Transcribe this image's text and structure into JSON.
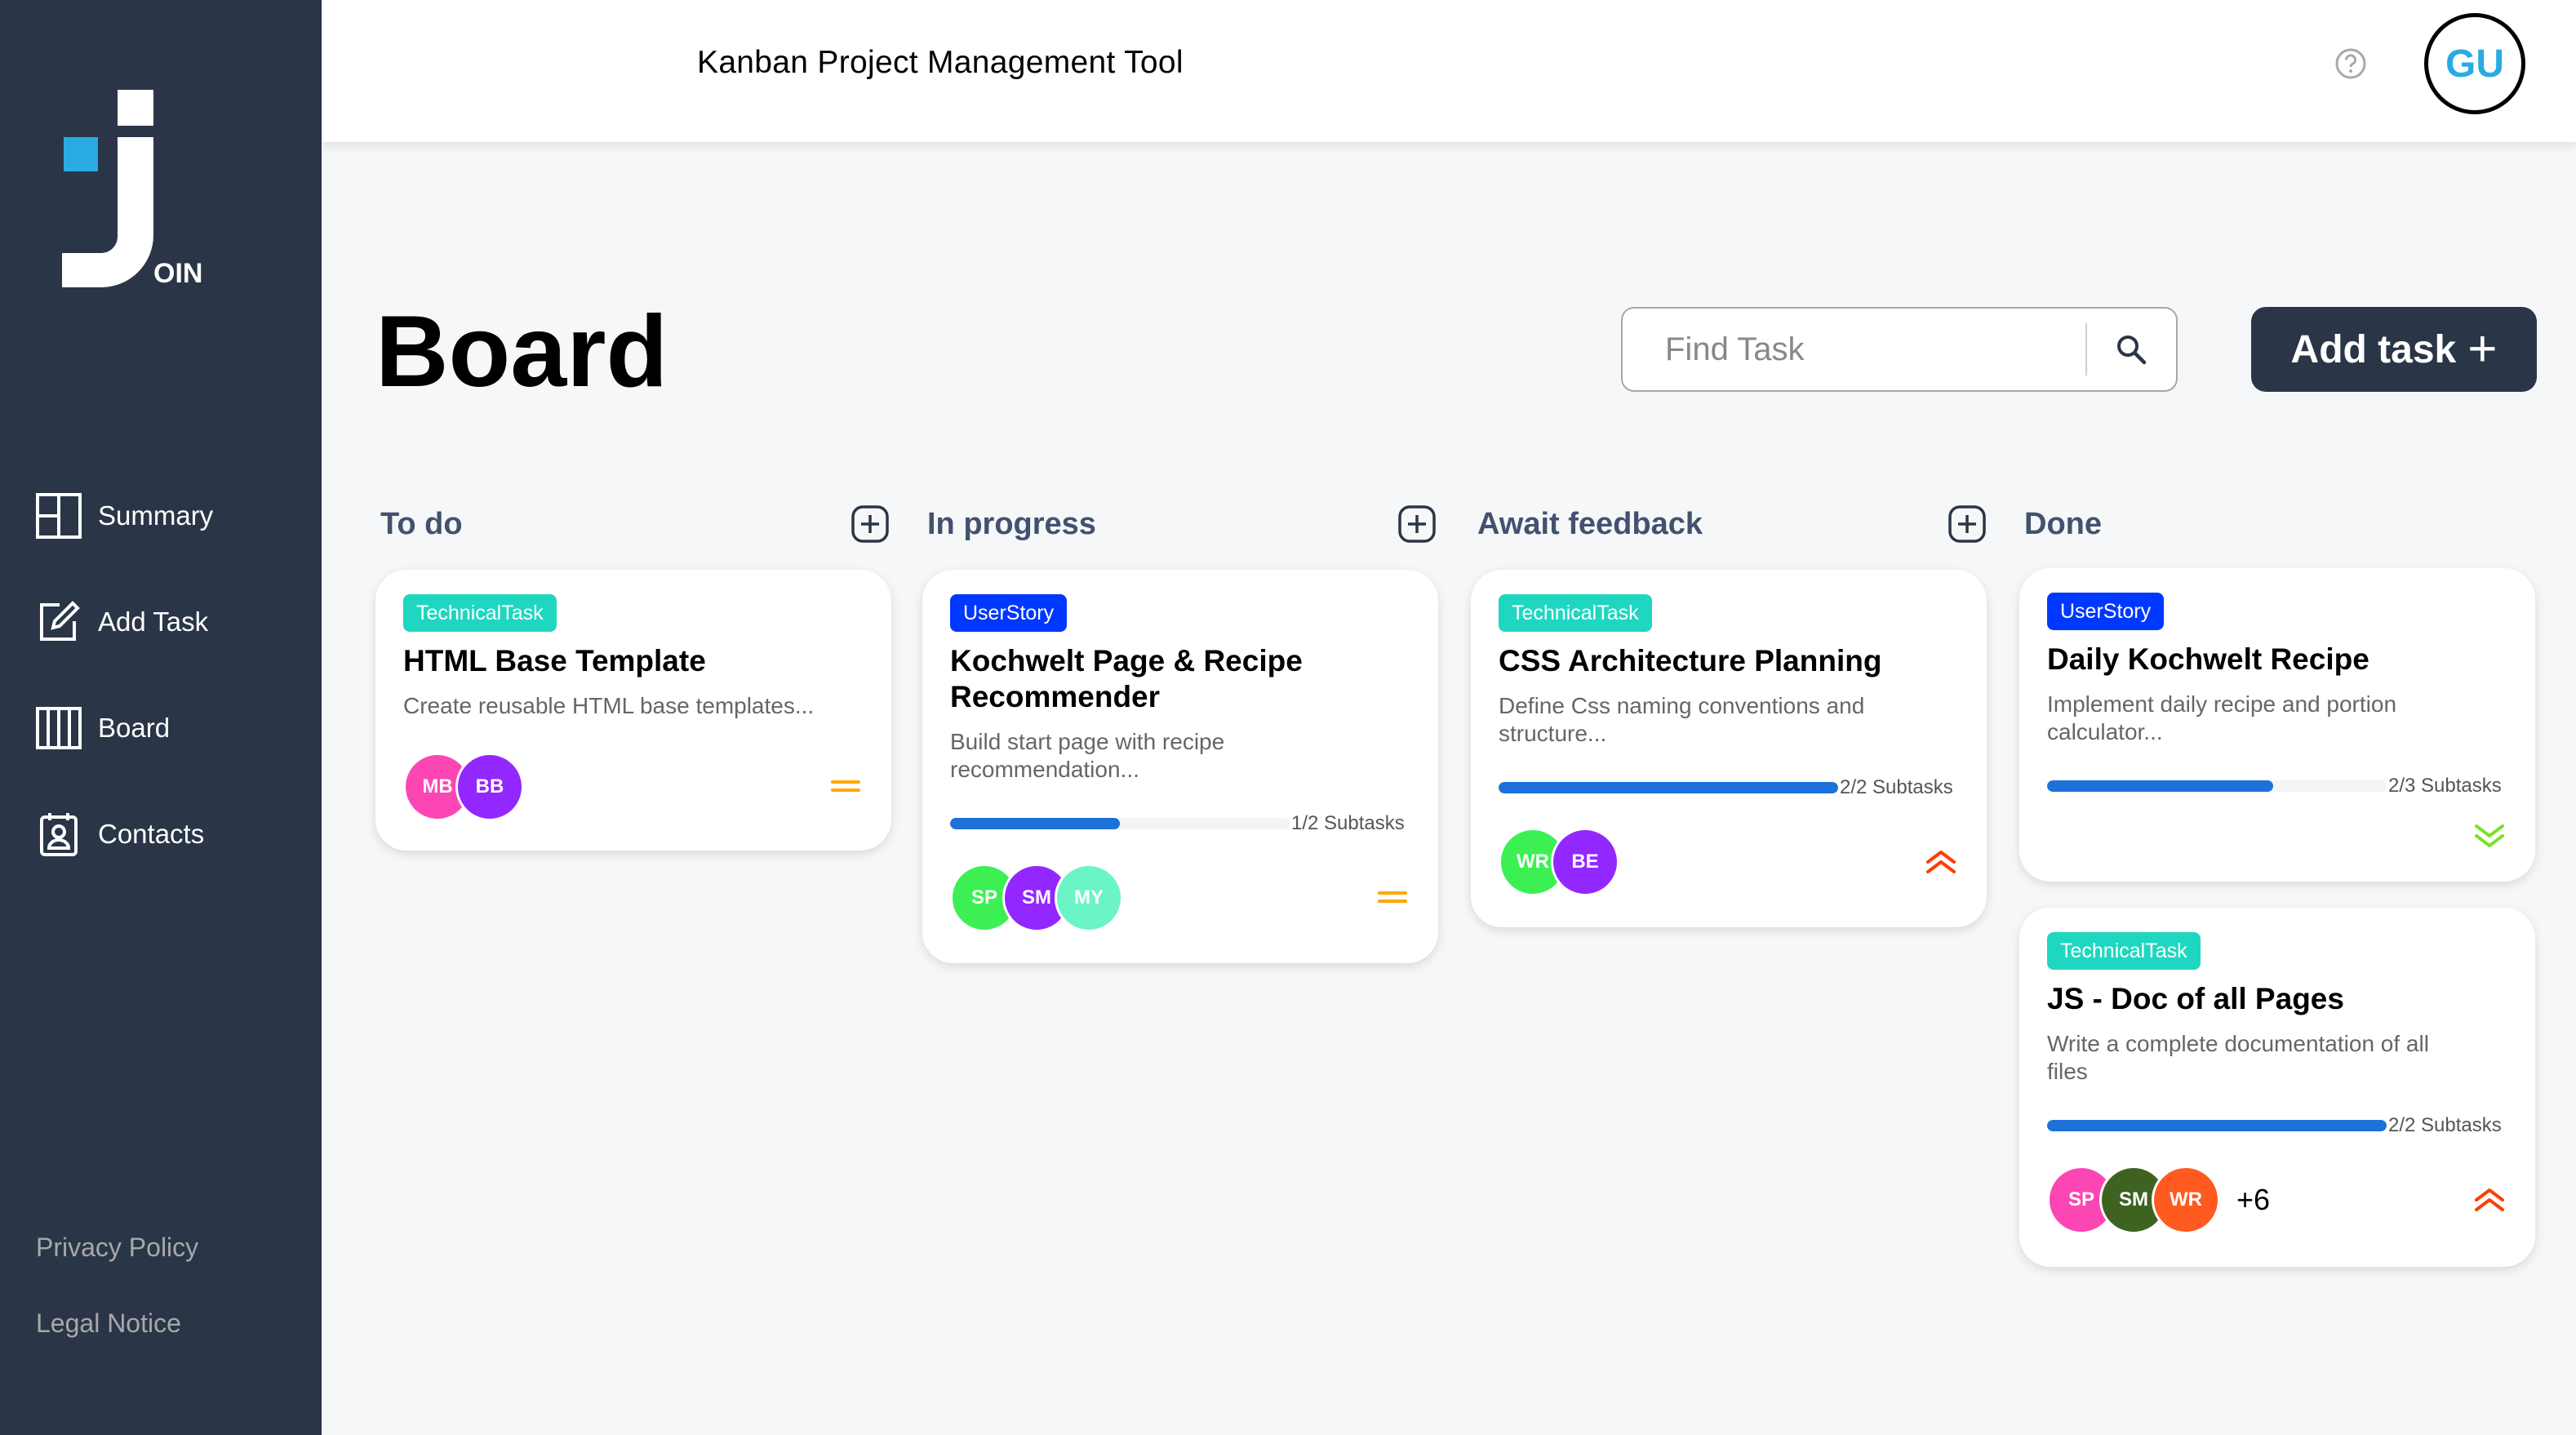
{
  "app": {
    "title": "Kanban Project Management Tool",
    "user_initials": "GU",
    "logo_text": "OIN"
  },
  "sidebar": {
    "items": [
      {
        "label": "Summary",
        "icon": "summary-icon"
      },
      {
        "label": "Add Task",
        "icon": "add-task-icon"
      },
      {
        "label": "Board",
        "icon": "board-icon"
      },
      {
        "label": "Contacts",
        "icon": "contacts-icon"
      }
    ],
    "footer": [
      "Privacy Policy",
      "Legal Notice"
    ]
  },
  "board": {
    "title": "Board",
    "search_placeholder": "Find Task",
    "add_task_label": "Add task"
  },
  "columns": [
    {
      "title": "To do",
      "has_add": true
    },
    {
      "title": "In progress",
      "has_add": true
    },
    {
      "title": "Await feedback",
      "has_add": true
    },
    {
      "title": "Done",
      "has_add": false
    }
  ],
  "cards": [
    {
      "category": "TechnicalTask",
      "title": "HTML Base Template",
      "description": "Create reusable HTML base templates...",
      "assignees": [
        "MB",
        "BB"
      ],
      "priority": "medium"
    },
    {
      "category": "UserStory",
      "title": "Kochwelt Page & Recipe Recommender",
      "description": "Build start page with recipe recommendation...",
      "subtasks": "1/2 Subtasks",
      "progress": 0.5,
      "assignees": [
        "SP",
        "SM",
        "MY"
      ],
      "priority": "medium"
    },
    {
      "category": "TechnicalTask",
      "title": "CSS Architecture Planning",
      "description": "Define Css naming conventions and structure...",
      "subtasks": "2/2 Subtasks",
      "progress": 1.0,
      "assignees": [
        "WR",
        "BE"
      ],
      "priority": "urgent"
    },
    {
      "category": "UserStory",
      "title": "Daily Kochwelt Recipe",
      "description": "Implement daily recipe and portion calculator...",
      "subtasks": "2/3 Subtasks",
      "progress": 0.667,
      "assignees": [],
      "priority": "low"
    },
    {
      "category": "TechnicalTask",
      "title": "JS - Doc of all Pages",
      "description": "Write a complete documentation of all files",
      "subtasks": "2/2 Subtasks",
      "progress": 1.0,
      "assignees": [
        "SP",
        "SM",
        "WR"
      ],
      "more_assignees": "+6",
      "priority": "urgent"
    }
  ],
  "colors": {
    "sidebar": "#2a3647",
    "technical_task": "#1fd7c1",
    "user_story": "#0038ff",
    "progress": "#1d71d9",
    "priority_medium": "#ffa800",
    "priority_urgent": "#ff3d00",
    "priority_low": "#7ae229",
    "avatar_MB": "#fc46b4",
    "avatar_BB": "#9327ff",
    "avatar_SP_todo": "#3cf054",
    "avatar_SM": "#9327ff",
    "avatar_MY": "#6bf4c8",
    "avatar_WR": "#3cf054",
    "avatar_BE": "#9327ff",
    "avatar_SP_done": "#fc46b4",
    "avatar_SM_done": "#3e6321",
    "avatar_WR_done": "#ff5a1f"
  }
}
